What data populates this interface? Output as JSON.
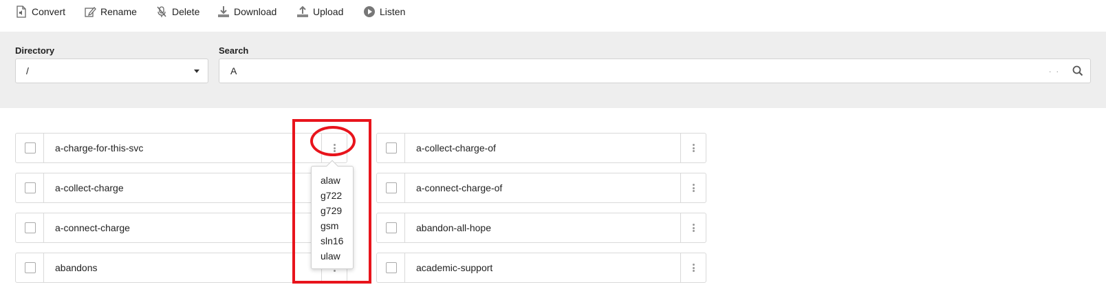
{
  "toolbar": {
    "convert": "Convert",
    "rename": "Rename",
    "delete": "Delete",
    "download": "Download",
    "upload": "Upload",
    "listen": "Listen"
  },
  "filter": {
    "directory_label": "Directory",
    "directory_value": "/",
    "search_label": "Search",
    "search_value": "A",
    "search_dots": ". ."
  },
  "files": {
    "left": [
      {
        "name": "a-charge-for-this-svc"
      },
      {
        "name": "a-collect-charge"
      },
      {
        "name": "a-connect-charge"
      },
      {
        "name": "abandons"
      }
    ],
    "right": [
      {
        "name": "a-collect-charge-of"
      },
      {
        "name": "a-connect-charge-of"
      },
      {
        "name": "abandon-all-hope"
      },
      {
        "name": "academic-support"
      }
    ]
  },
  "format_menu": {
    "options": [
      "alaw",
      "g722",
      "g729",
      "gsm",
      "sln16",
      "ulaw"
    ]
  },
  "colors": {
    "highlight": "#e8141c",
    "panel_bg": "#eeeeee",
    "border": "#d9d9d9"
  },
  "icons": {
    "convert": "audio-file-icon",
    "rename": "edit-icon",
    "delete": "mic-off-icon",
    "download": "download-icon",
    "upload": "upload-icon",
    "listen": "play-circle-icon",
    "search": "search-icon",
    "kebab": "kebab-menu-icon"
  }
}
